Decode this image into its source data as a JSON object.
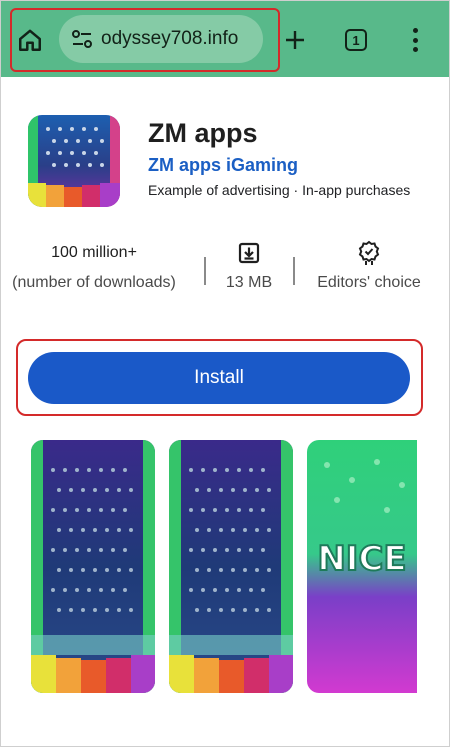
{
  "browser": {
    "url_text": "odyssey708.info",
    "tab_count": "1",
    "toolbar_color": "#58b98a",
    "icons": [
      "home-icon",
      "site-settings-icon",
      "new-tab-icon",
      "tab-switcher-icon",
      "menu-icon"
    ]
  },
  "app": {
    "title": "ZM apps",
    "developer": "ZM apps iGaming",
    "meta": "Example of advertising · In-app purchases"
  },
  "stats": {
    "downloads_value": "100 million+",
    "downloads_label": "(number of downloads)",
    "size_label": "13 MB",
    "editors_label": "Editors' choice"
  },
  "install": {
    "label": "Install",
    "color": "#1a59c8"
  },
  "screenshots": {
    "third_text": "NICE"
  },
  "highlight_color": "#d42a2a"
}
